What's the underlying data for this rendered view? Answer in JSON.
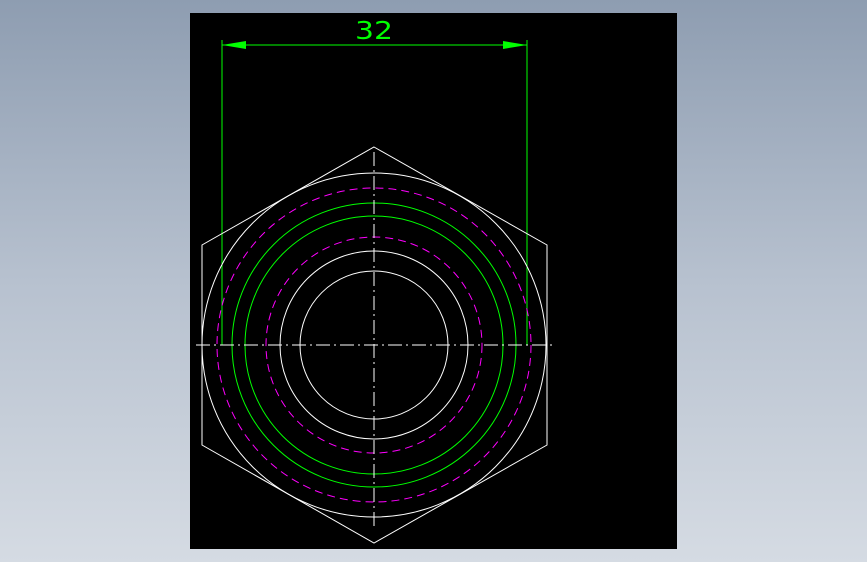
{
  "drawing": {
    "dimension_label": "32"
  },
  "colors": {
    "background_top": "#8e9db1",
    "background_bottom": "#d5dbe3",
    "canvas": "#000000",
    "geometry": "#ffffff",
    "dimension": "#00ff00",
    "thread_hidden": "#ff00ff"
  }
}
